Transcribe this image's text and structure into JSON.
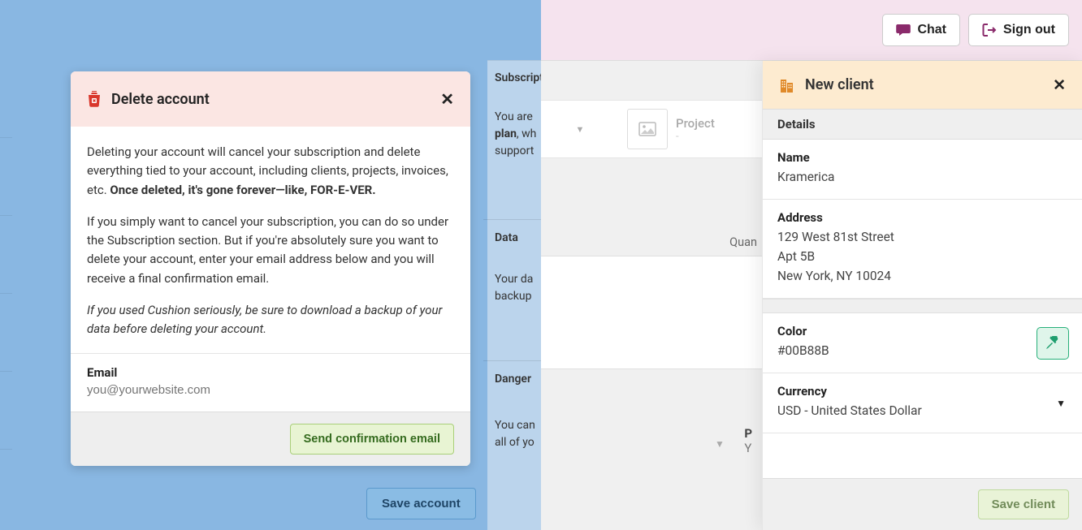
{
  "left": {
    "save_account": "Save account",
    "sections": {
      "subscription": {
        "label": "Subscription",
        "line1": "You are",
        "plan": "plan",
        "line3": "support"
      },
      "data": {
        "label": "Data",
        "line1": "Your da",
        "line2": "backup"
      },
      "danger": {
        "label": "Danger",
        "line1": "You can",
        "line2": "all of yo"
      }
    }
  },
  "delete_modal": {
    "title": "Delete account",
    "para1_a": "Deleting your account will cancel your subscription and delete everything tied to your account, including clients, projects, invoices, etc. ",
    "para1_b": "Once deleted, it's gone forever—like, FOR-E-VER.",
    "para2": "If you simply want to cancel your subscription, you can do so under the Subscription section. But if you're absolutely sure you want to delete your account, enter your email address below and you will receive a final confirmation email.",
    "para3": "If you used Cushion seriously, be sure to download a backup of your data before deleting your account.",
    "email_label": "Email",
    "email_placeholder": "you@yourwebsite.com",
    "send_button": "Send confirmation email"
  },
  "header": {
    "chat": "Chat",
    "sign_out": "Sign out"
  },
  "mid": {
    "project_label": "Project",
    "project_dash": "-",
    "quantity_header": "Quan",
    "p_label": "P",
    "y_label": "Y"
  },
  "client_panel": {
    "title": "New client",
    "details": "Details",
    "name_label": "Name",
    "name_value": "Kramerica",
    "address_label": "Address",
    "address_line1": "129 West 81st Street",
    "address_line2": "Apt 5B",
    "address_line3": "New York, NY 10024",
    "color_label": "Color",
    "color_value": "#00B88B",
    "currency_label": "Currency",
    "currency_value": "USD - United States Dollar",
    "save_button": "Save client"
  }
}
